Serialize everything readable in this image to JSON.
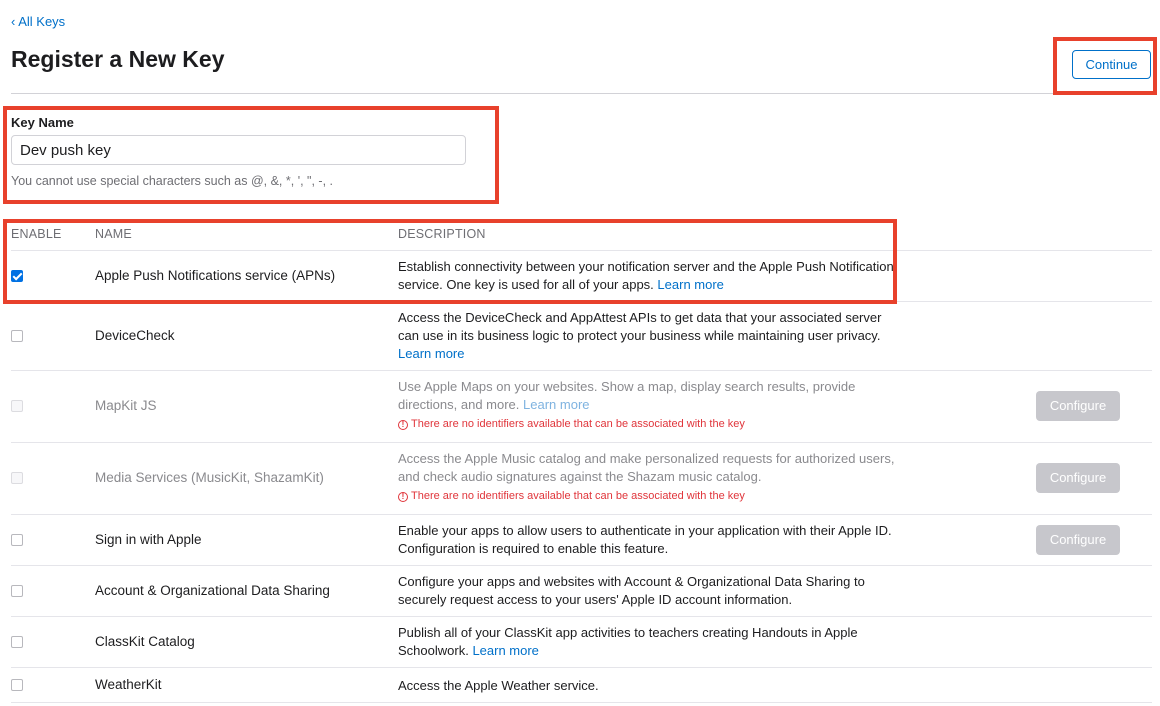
{
  "nav": {
    "back_label": "‹ All Keys"
  },
  "header": {
    "title": "Register a New Key",
    "continue_label": "Continue"
  },
  "key_form": {
    "label": "Key Name",
    "value": "Dev push key",
    "hint": "You cannot use special characters such as @, &, *, ', \", -, ."
  },
  "table": {
    "columns": [
      "ENABLE",
      "NAME",
      "DESCRIPTION"
    ],
    "rows": [
      {
        "name": "Apple Push Notifications service (APNs)",
        "enabled": true,
        "disabled": false,
        "description": "Establish connectivity between your notification server and the Apple Push Notification service. One key is used for all of your apps.",
        "learn_more": "Learn more"
      },
      {
        "name": "DeviceCheck",
        "enabled": false,
        "disabled": false,
        "description": "Access the DeviceCheck and AppAttest APIs to get data that your associated server can use in its business logic to protect your business while maintaining user privacy.",
        "learn_more": "Learn more"
      },
      {
        "name": "MapKit JS",
        "enabled": false,
        "disabled": true,
        "description": "Use Apple Maps on your websites. Show a map, display search results, provide directions, and more.",
        "learn_more": "Learn more",
        "warning": "There are no identifiers available that can be associated with the key",
        "configure": "Configure"
      },
      {
        "name": "Media Services (MusicKit, ShazamKit)",
        "enabled": false,
        "disabled": true,
        "description": "Access the Apple Music catalog and make personalized requests for authorized users, and check audio signatures against the Shazam music catalog.",
        "warning": "There are no identifiers available that can be associated with the key",
        "configure": "Configure"
      },
      {
        "name": "Sign in with Apple",
        "enabled": false,
        "disabled": false,
        "description": "Enable your apps to allow users to authenticate in your application with their Apple ID. Configuration is required to enable this feature.",
        "configure": "Configure"
      },
      {
        "name": "Account & Organizational Data Sharing",
        "enabled": false,
        "disabled": false,
        "description": "Configure your apps and websites with Account & Organizational Data Sharing to securely request access to your users' Apple ID account information."
      },
      {
        "name": "ClassKit Catalog",
        "enabled": false,
        "disabled": false,
        "description": "Publish all of your ClassKit app activities to teachers creating Handouts in Apple Schoolwork.",
        "learn_more": "Learn more"
      },
      {
        "name": "WeatherKit",
        "enabled": false,
        "disabled": false,
        "description": "Access the Apple Weather service."
      }
    ]
  },
  "colors": {
    "accent": "#0070c9",
    "highlight": "#e8412c",
    "error": "#e0353b",
    "disabled_button": "#c7c7cc"
  }
}
